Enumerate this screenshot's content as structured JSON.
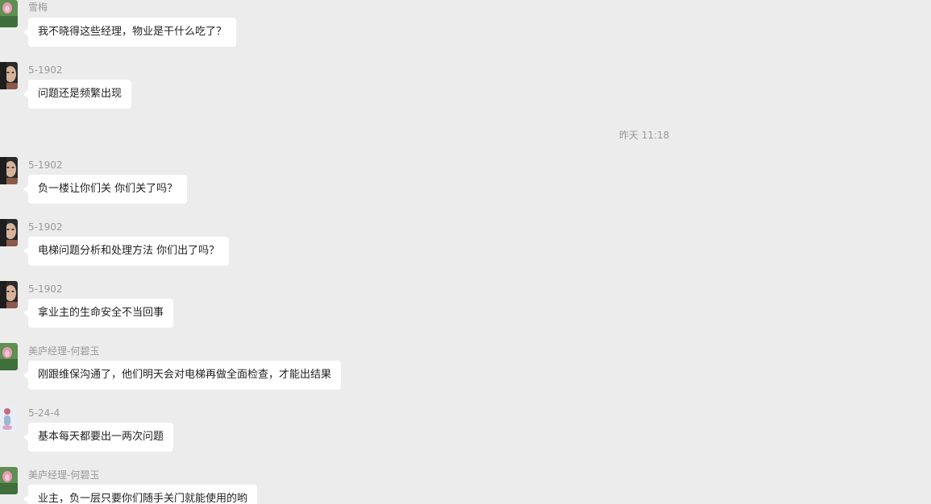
{
  "timestamp": "昨天 11:18",
  "messages": [
    {
      "sender": "雪梅",
      "text": "我不晓得这些经理，物业是干什么吃了？",
      "avatar": "lotus-avatar"
    },
    {
      "sender": "5-1902",
      "text": "问题还是频繁出现",
      "avatar": "face-avatar"
    },
    {
      "sender": "5-1902",
      "text": "负一楼让你们关 你们关了吗？",
      "avatar": "face-avatar"
    },
    {
      "sender": "5-1902",
      "text": "电梯问题分析和处理方法 你们出了吗？",
      "avatar": "face-avatar"
    },
    {
      "sender": "5-1902",
      "text": "拿业主的生命安全不当回事",
      "avatar": "face-avatar"
    },
    {
      "sender": "美庐经理-何碧玉",
      "text": "刚跟维保沟通了，他们明天会对电梯再做全面检查，才能出结果",
      "avatar": "lotus-avatar"
    },
    {
      "sender": "5-24-4",
      "text": "基本每天都要出一两次问题",
      "avatar": "doll-avatar"
    },
    {
      "sender": "美庐经理-何碧玉",
      "text": "业主，负一层只要你们随手关门就能使用的哟",
      "avatar": "lotus-avatar"
    }
  ]
}
